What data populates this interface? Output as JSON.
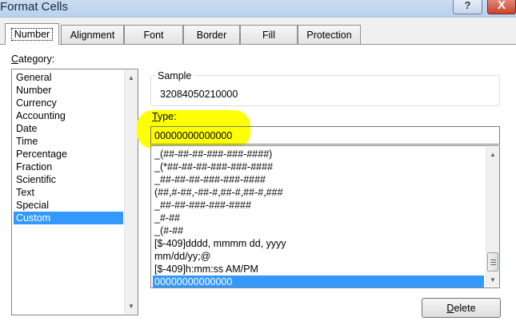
{
  "window": {
    "title": "Format Cells",
    "help_glyph": "?",
    "close_glyph": "X"
  },
  "tabs": [
    {
      "label": "Number"
    },
    {
      "label": "Alignment"
    },
    {
      "label": "Font"
    },
    {
      "label": "Border"
    },
    {
      "label": "Fill"
    },
    {
      "label": "Protection"
    }
  ],
  "category": {
    "label_access": "C",
    "label_rest": "ategory:",
    "items": [
      "General",
      "Number",
      "Currency",
      "Accounting",
      "Date",
      "Time",
      "Percentage",
      "Fraction",
      "Scientific",
      "Text",
      "Special",
      "Custom"
    ],
    "selected": "Custom"
  },
  "sample": {
    "legend": "Sample",
    "value": "32084050210000"
  },
  "type": {
    "label_access": "T",
    "label_rest": "ype:",
    "value": "00000000000000",
    "highlight_color": "#ffff00"
  },
  "formats": {
    "items": [
      "_(##-##-##-###-###-####)",
      "_(*##-##-##-###-###-####",
      "_##-##-##-###-###-####",
      "(##,#-##,-##-#,##-#,##-#,###",
      "_##-##-###-###-####",
      "_#-##",
      "_(#-##",
      "[$-409]dddd, mmmm dd, yyyy",
      "mm/dd/yy;@",
      "[$-409]h:mm:ss AM/PM",
      "00000000000000"
    ],
    "selected": "00000000000000"
  },
  "buttons": {
    "delete_access": "D",
    "delete_rest": "elete"
  },
  "scroll_arrows": {
    "up": "▲",
    "down": "▼"
  },
  "colors": {
    "selection": "#3399ff",
    "titlebar": "#c9dcf3",
    "close_button": "#c9442c"
  }
}
